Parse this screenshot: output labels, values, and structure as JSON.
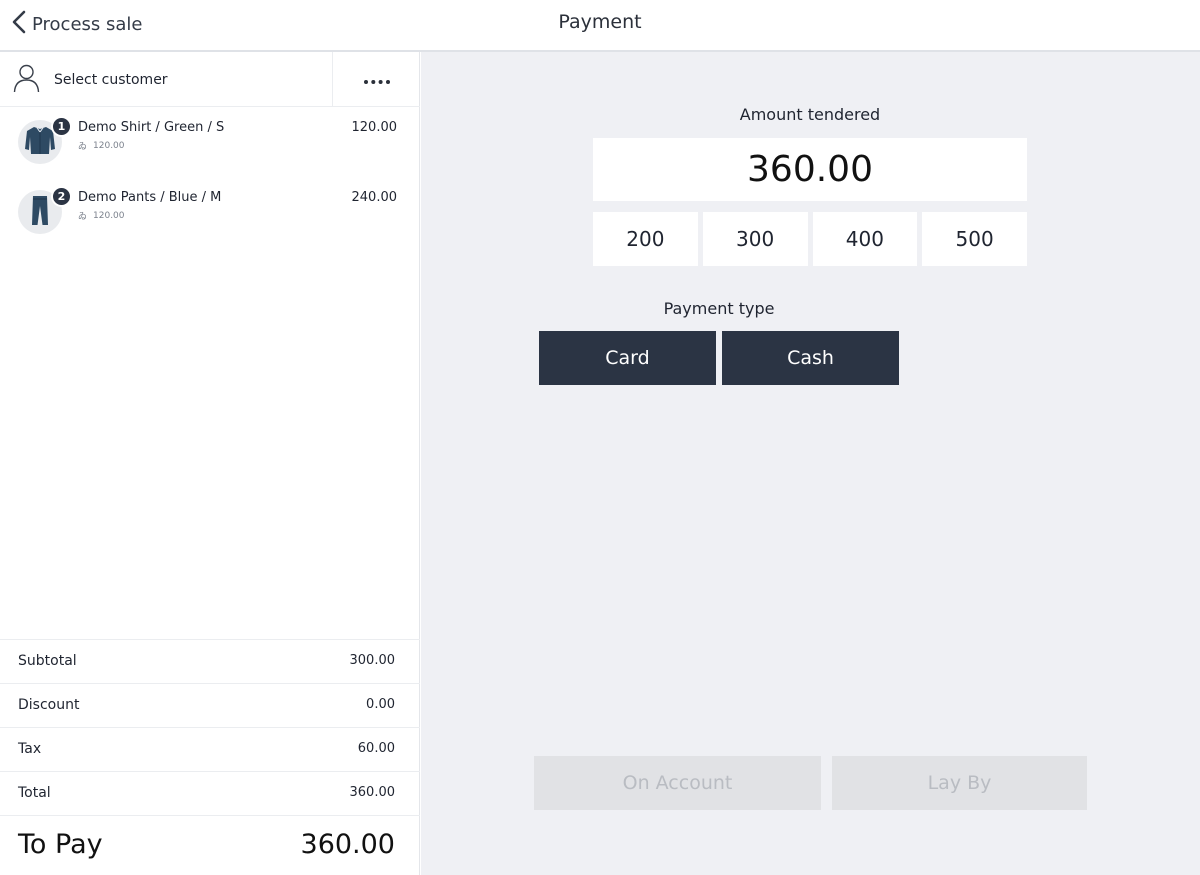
{
  "header": {
    "back_label": "Process sale",
    "title": "Payment"
  },
  "customer": {
    "select_label": "Select customer"
  },
  "items": [
    {
      "qty": "1",
      "name": "Demo Shirt / Green / S",
      "unit_price": "120.00",
      "price": "120.00",
      "icon": "shirt-icon"
    },
    {
      "qty": "2",
      "name": "Demo Pants / Blue / M",
      "unit_price": "120.00",
      "price": "240.00",
      "icon": "pants-icon"
    }
  ],
  "totals": {
    "subtotal_label": "Subtotal",
    "subtotal": "300.00",
    "discount_label": "Discount",
    "discount": "0.00",
    "tax_label": "Tax",
    "tax": "60.00",
    "total_label": "Total",
    "total": "360.00",
    "topay_label": "To Pay",
    "topay": "360.00"
  },
  "payment": {
    "amount_label": "Amount tendered",
    "amount_value": "360.00",
    "quick_amounts": [
      "200",
      "300",
      "400",
      "500"
    ],
    "type_label": "Payment type",
    "types": [
      "Card",
      "Cash"
    ],
    "on_account": "On Account",
    "lay_by": "Lay By"
  },
  "colors": {
    "accent": "#2b3444",
    "panel_bg": "#eff0f4",
    "disabled_bg": "#e1e2e5",
    "disabled_text": "#b9bcc2"
  }
}
